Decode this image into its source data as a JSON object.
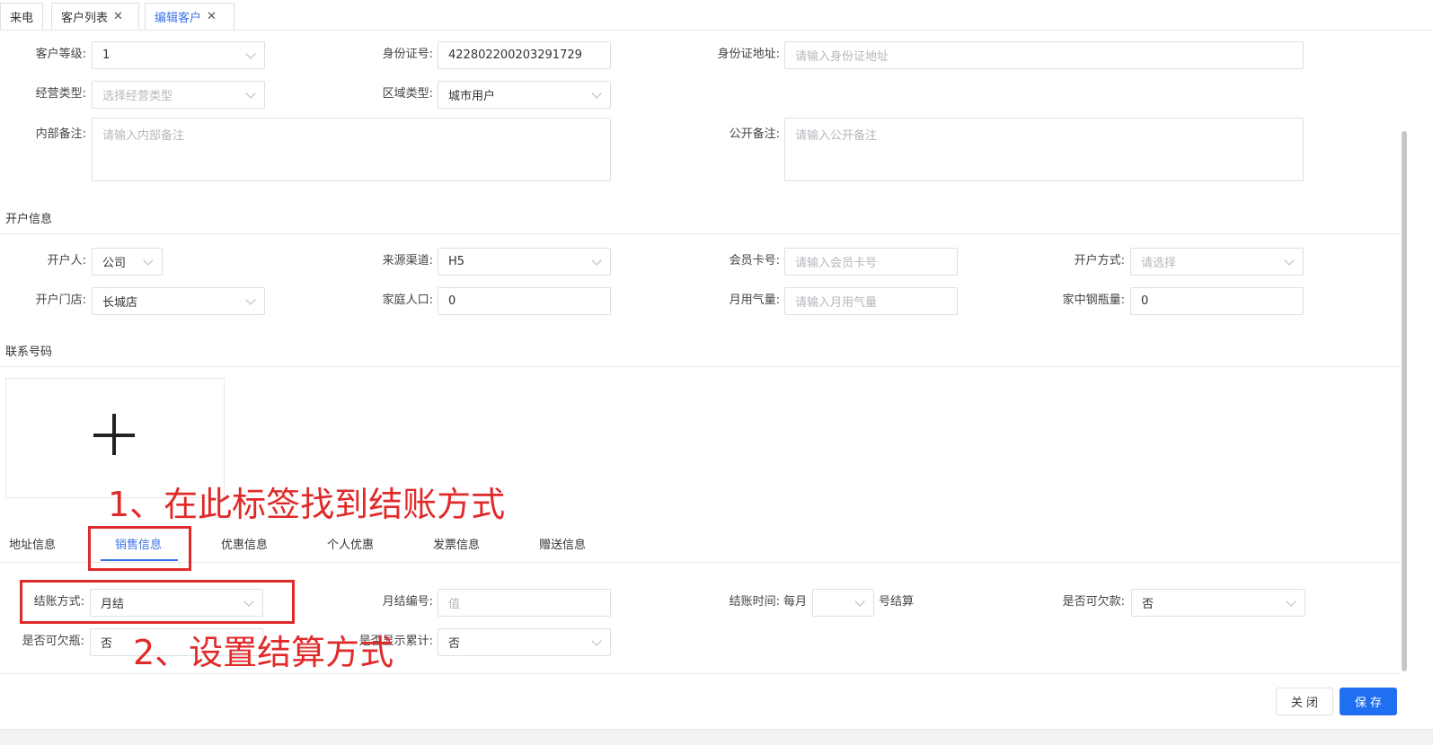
{
  "tabs": [
    {
      "label": "来电",
      "closable": false
    },
    {
      "label": "客户列表",
      "closable": true
    },
    {
      "label": "编辑客户",
      "closable": true,
      "active": true
    }
  ],
  "basic": {
    "level_label": "客户等级:",
    "level_value": "1",
    "id_label": "身份证号:",
    "id_value": "422802200203291729",
    "id_addr_label": "身份证地址:",
    "id_addr_placeholder": "请输入身份证地址",
    "biz_type_label": "经营类型:",
    "biz_type_placeholder": "选择经营类型",
    "region_label": "区域类型:",
    "region_value": "城市用户",
    "inner_note_label": "内部备注:",
    "inner_note_placeholder": "请输入内部备注",
    "public_note_label": "公开备注:",
    "public_note_placeholder": "请输入公开备注"
  },
  "open_section": {
    "title": "开户信息",
    "opener_label": "开户人:",
    "opener_value": "公司",
    "channel_label": "来源渠道:",
    "channel_value": "H5",
    "card_label": "会员卡号:",
    "card_placeholder": "请输入会员卡号",
    "method_label": "开户方式:",
    "method_placeholder": "请选择",
    "store_label": "开户门店:",
    "store_value": "长城店",
    "family_label": "家庭人口:",
    "family_value": "0",
    "gas_label": "月用气量:",
    "gas_placeholder": "请输入月用气量",
    "cylinder_label": "家中钢瓶量:",
    "cylinder_value": "0"
  },
  "contact_section": {
    "title": "联系号码"
  },
  "subtabs": [
    "地址信息",
    "销售信息",
    "优惠信息",
    "个人优惠",
    "发票信息",
    "赠送信息"
  ],
  "sales": {
    "settle_label": "结账方式:",
    "settle_value": "月结",
    "monthly_no_label": "月结编号:",
    "monthly_no_placeholder": "值",
    "settle_time_label": "结账时间:",
    "settle_time_prefix": "每月",
    "settle_time_suffix": "号结算",
    "credit_label": "是否可欠款:",
    "credit_value": "否",
    "bottle_label": "是否可欠瓶:",
    "bottle_value": "否",
    "accum_label": "是否显示累计:",
    "accum_value": "否"
  },
  "annotations": {
    "step1": "1、在此标签找到结账方式",
    "step2": "2、设置结算方式"
  },
  "footer": {
    "close_label": "关 闭",
    "save_label": "保 存"
  },
  "colors": {
    "accent": "#3a73e8",
    "primary_button": "#1f6ff0",
    "annotation": "#e02a2a"
  }
}
